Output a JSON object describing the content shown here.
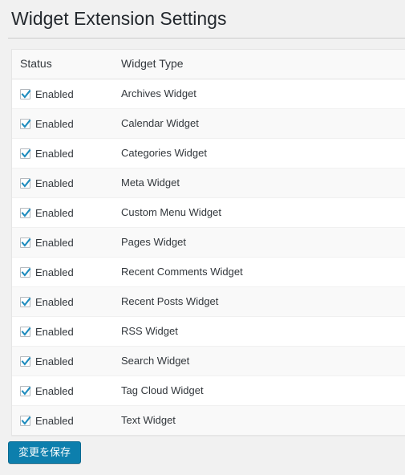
{
  "page": {
    "title": "Widget Extension Settings",
    "background_color": "#f1f1f1"
  },
  "table": {
    "columns": [
      {
        "key": "status",
        "label": "Status"
      },
      {
        "key": "type",
        "label": "Widget Type"
      }
    ],
    "rows": [
      {
        "status_label": "Enabled",
        "checked": true,
        "type": "Archives Widget"
      },
      {
        "status_label": "Enabled",
        "checked": true,
        "type": "Calendar Widget"
      },
      {
        "status_label": "Enabled",
        "checked": true,
        "type": "Categories Widget"
      },
      {
        "status_label": "Enabled",
        "checked": true,
        "type": "Meta Widget"
      },
      {
        "status_label": "Enabled",
        "checked": true,
        "type": "Custom Menu Widget"
      },
      {
        "status_label": "Enabled",
        "checked": true,
        "type": "Pages Widget"
      },
      {
        "status_label": "Enabled",
        "checked": true,
        "type": "Recent Comments Widget"
      },
      {
        "status_label": "Enabled",
        "checked": true,
        "type": "Recent Posts Widget"
      },
      {
        "status_label": "Enabled",
        "checked": true,
        "type": "RSS Widget"
      },
      {
        "status_label": "Enabled",
        "checked": true,
        "type": "Search Widget"
      },
      {
        "status_label": "Enabled",
        "checked": true,
        "type": "Tag Cloud Widget"
      },
      {
        "status_label": "Enabled",
        "checked": true,
        "type": "Text Widget"
      }
    ]
  },
  "submit": {
    "save_label": "変更を保存",
    "accent_color": "#0d7fad"
  },
  "icons": {
    "checkmark": "checkmark-icon",
    "checkmark_color": "#1e8cbe"
  }
}
